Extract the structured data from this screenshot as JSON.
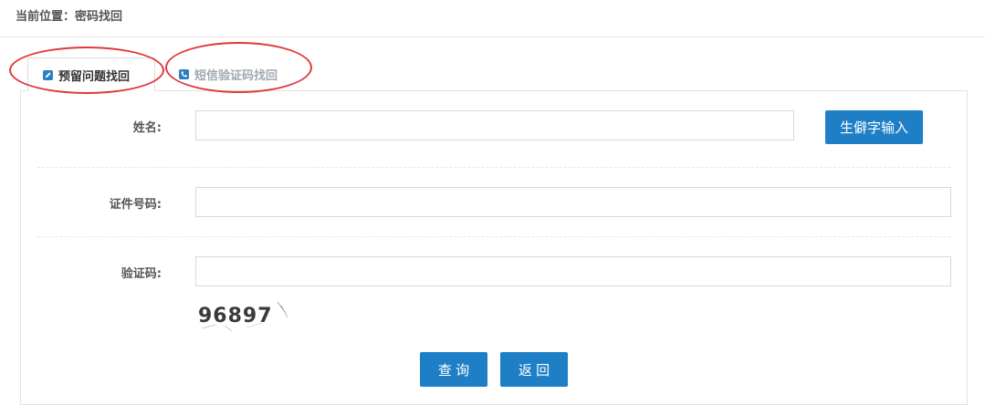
{
  "breadcrumb": {
    "prefix": "当前位置：",
    "current": "密码找回"
  },
  "tabs": [
    {
      "label": "预留问题找回",
      "icon": "pencil-icon",
      "active": true
    },
    {
      "label": "短信验证码找回",
      "icon": "phone-icon",
      "active": false
    }
  ],
  "form": {
    "name_label": "姓名:",
    "name_value": "",
    "rare_char_button": "生僻字输入",
    "id_label": "证件号码:",
    "id_value": "",
    "captcha_label": "验证码:",
    "captcha_value": "",
    "captcha_text": "96897"
  },
  "actions": {
    "query": "查 询",
    "back": "返 回"
  },
  "colors": {
    "accent": "#1f7fc6",
    "highlight_ring": "#e03a3a",
    "inactive_tab": "#a0a8b3"
  }
}
